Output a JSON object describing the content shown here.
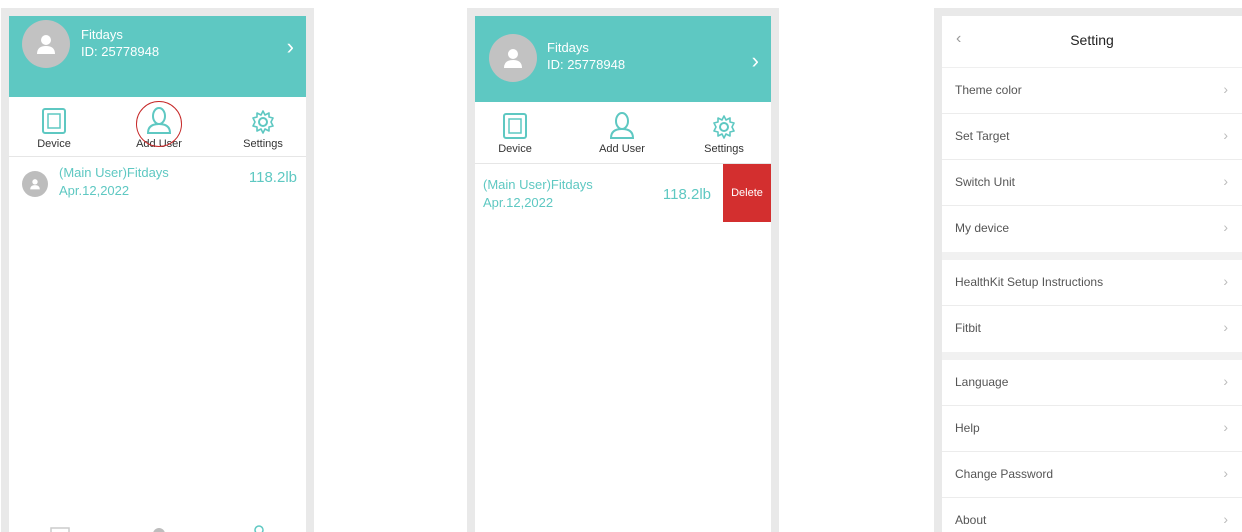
{
  "profile": {
    "name": "Fitdays",
    "id": "ID: 25778948"
  },
  "toolbar": {
    "device": "Device",
    "add_user": "Add User",
    "settings": "Settings"
  },
  "users": [
    {
      "name": "(Main User)Fitdays",
      "date": "Apr.12,2022",
      "weight": "118.2lb"
    }
  ],
  "actions": {
    "delete": "Delete"
  },
  "settings": {
    "title": "Setting",
    "groups": [
      [
        "Theme color",
        "Set Target",
        "Switch Unit",
        "My device"
      ],
      [
        "HealthKit Setup Instructions",
        "Fitbit"
      ],
      [
        "Language",
        "Help",
        "Change Password",
        "About"
      ]
    ]
  },
  "colors": {
    "teal": "#5ec8c2",
    "delete_red": "#d32f2f",
    "highlight_ring": "#c62828"
  },
  "icons": [
    "device-icon",
    "add-user-icon",
    "settings-gear-icon",
    "chevron-right-icon",
    "back-chevron-icon",
    "person-icon"
  ]
}
